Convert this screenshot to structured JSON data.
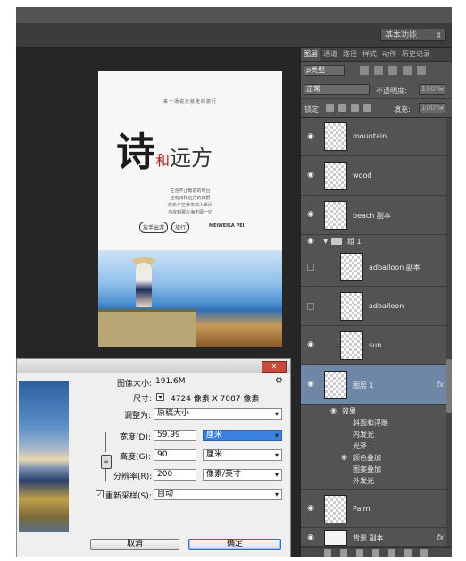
{
  "workspace": {
    "label": "基本功能"
  },
  "panel": {
    "tabs": [
      "图层",
      "通道",
      "路径",
      "样式",
      "动作",
      "历史记录"
    ],
    "kind_filter": "ρ类型",
    "blend_mode": "正常",
    "opacity_label": "不透明度:",
    "opacity_value": "100%",
    "lock_label": "锁定:",
    "fill_label": "填充:",
    "fill_value": "100%"
  },
  "layers": [
    {
      "name": "mountain",
      "visible": true
    },
    {
      "name": "wood",
      "visible": true
    },
    {
      "name": "beach 副本",
      "visible": true
    },
    {
      "name": "组 1",
      "type": "group",
      "visible": true
    },
    {
      "name": "adballoon 副本",
      "visible": false
    },
    {
      "name": "adballoon",
      "visible": false
    },
    {
      "name": "sun",
      "visible": true
    },
    {
      "name": "图层 1",
      "visible": true,
      "selected": true,
      "fx": "fx"
    },
    {
      "name": "Palm",
      "visible": true
    },
    {
      "name": "背景 副本",
      "visible": true,
      "fx": "fx"
    }
  ],
  "effects": {
    "header": "效果",
    "items": [
      "斜面和浮雕",
      "内发光",
      "光泽",
      "颜色叠加",
      "图案叠加",
      "外发光"
    ]
  },
  "poster": {
    "tagline": "来一场说走就走的旅行",
    "title_big": "诗",
    "title_he": "和",
    "title_rest": "远方",
    "lines": [
      "生活不止眼前的苟且",
      "还有诗和远方的田野",
      "你赤手空拳来到人世间",
      "为找到那片海不顾一切"
    ],
    "badges": [
      "放手出游",
      "旅行"
    ],
    "brand": "MEIWEIKA PEI"
  },
  "dialog": {
    "image_size_label": "图像大小:",
    "image_size_value": "191.6M",
    "dimensions_label": "尺寸:",
    "dimensions_value": "4724 像素 X 7087 像素",
    "fit_label": "调整为:",
    "fit_value": "原稿大小",
    "width_label": "宽度(D):",
    "width_value": "59.99",
    "width_unit": "厘米",
    "height_label": "高度(G):",
    "height_value": "90",
    "height_unit": "厘米",
    "resolution_label": "分辨率(R):",
    "resolution_value": "200",
    "resolution_unit": "像素/英寸",
    "resample_label": "重新采样(S):",
    "resample_checked": true,
    "resample_value": "自动",
    "cancel_label": "取消",
    "ok_label": "确定"
  }
}
